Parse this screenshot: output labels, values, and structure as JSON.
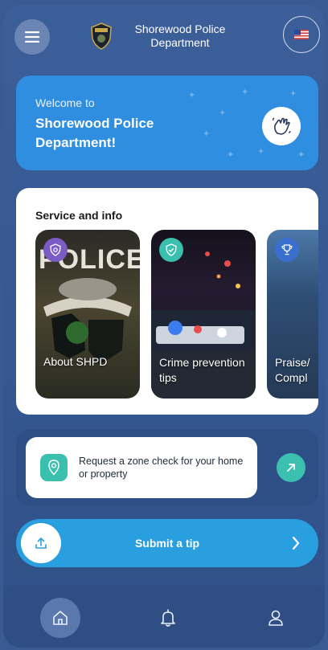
{
  "header": {
    "title_line1": "Shorewood Police",
    "title_line2": "Department",
    "badge_text": "POLICE",
    "menu_icon": "hamburger-menu-icon",
    "language_icon": "us-flag-icon"
  },
  "welcome": {
    "subtitle": "Welcome to",
    "title": "Shorewood Police Department!",
    "icon": "waving-hand-icon"
  },
  "services": {
    "heading": "Service and info",
    "cards": [
      {
        "label": "About SHPD",
        "icon": "police-badge-icon",
        "icon_color": "#7b5cc4"
      },
      {
        "label": "Crime prevention tips",
        "icon": "shield-check-icon",
        "icon_color": "#3bbfae"
      },
      {
        "label": "Praise/ Compl",
        "icon": "trophy-icon",
        "icon_color": "#3a6fd0"
      }
    ]
  },
  "zone_check": {
    "text": "Request a zone check for your home or property",
    "icon": "location-pin-icon",
    "arrow_icon": "arrow-up-right-icon"
  },
  "submit_tip": {
    "label": "Submit a tip",
    "icon": "upload-icon",
    "chevron_icon": "chevron-right-icon"
  },
  "nav": {
    "items": [
      {
        "name": "home",
        "icon": "home-icon",
        "active": true
      },
      {
        "name": "notifications",
        "icon": "bell-icon",
        "active": false
      },
      {
        "name": "profile",
        "icon": "user-icon",
        "active": false
      }
    ]
  },
  "colors": {
    "background": "#3d5f99",
    "welcome_card": "#2f8ee0",
    "accent_teal": "#3bbfae",
    "tip_button": "#2a9fe0"
  }
}
